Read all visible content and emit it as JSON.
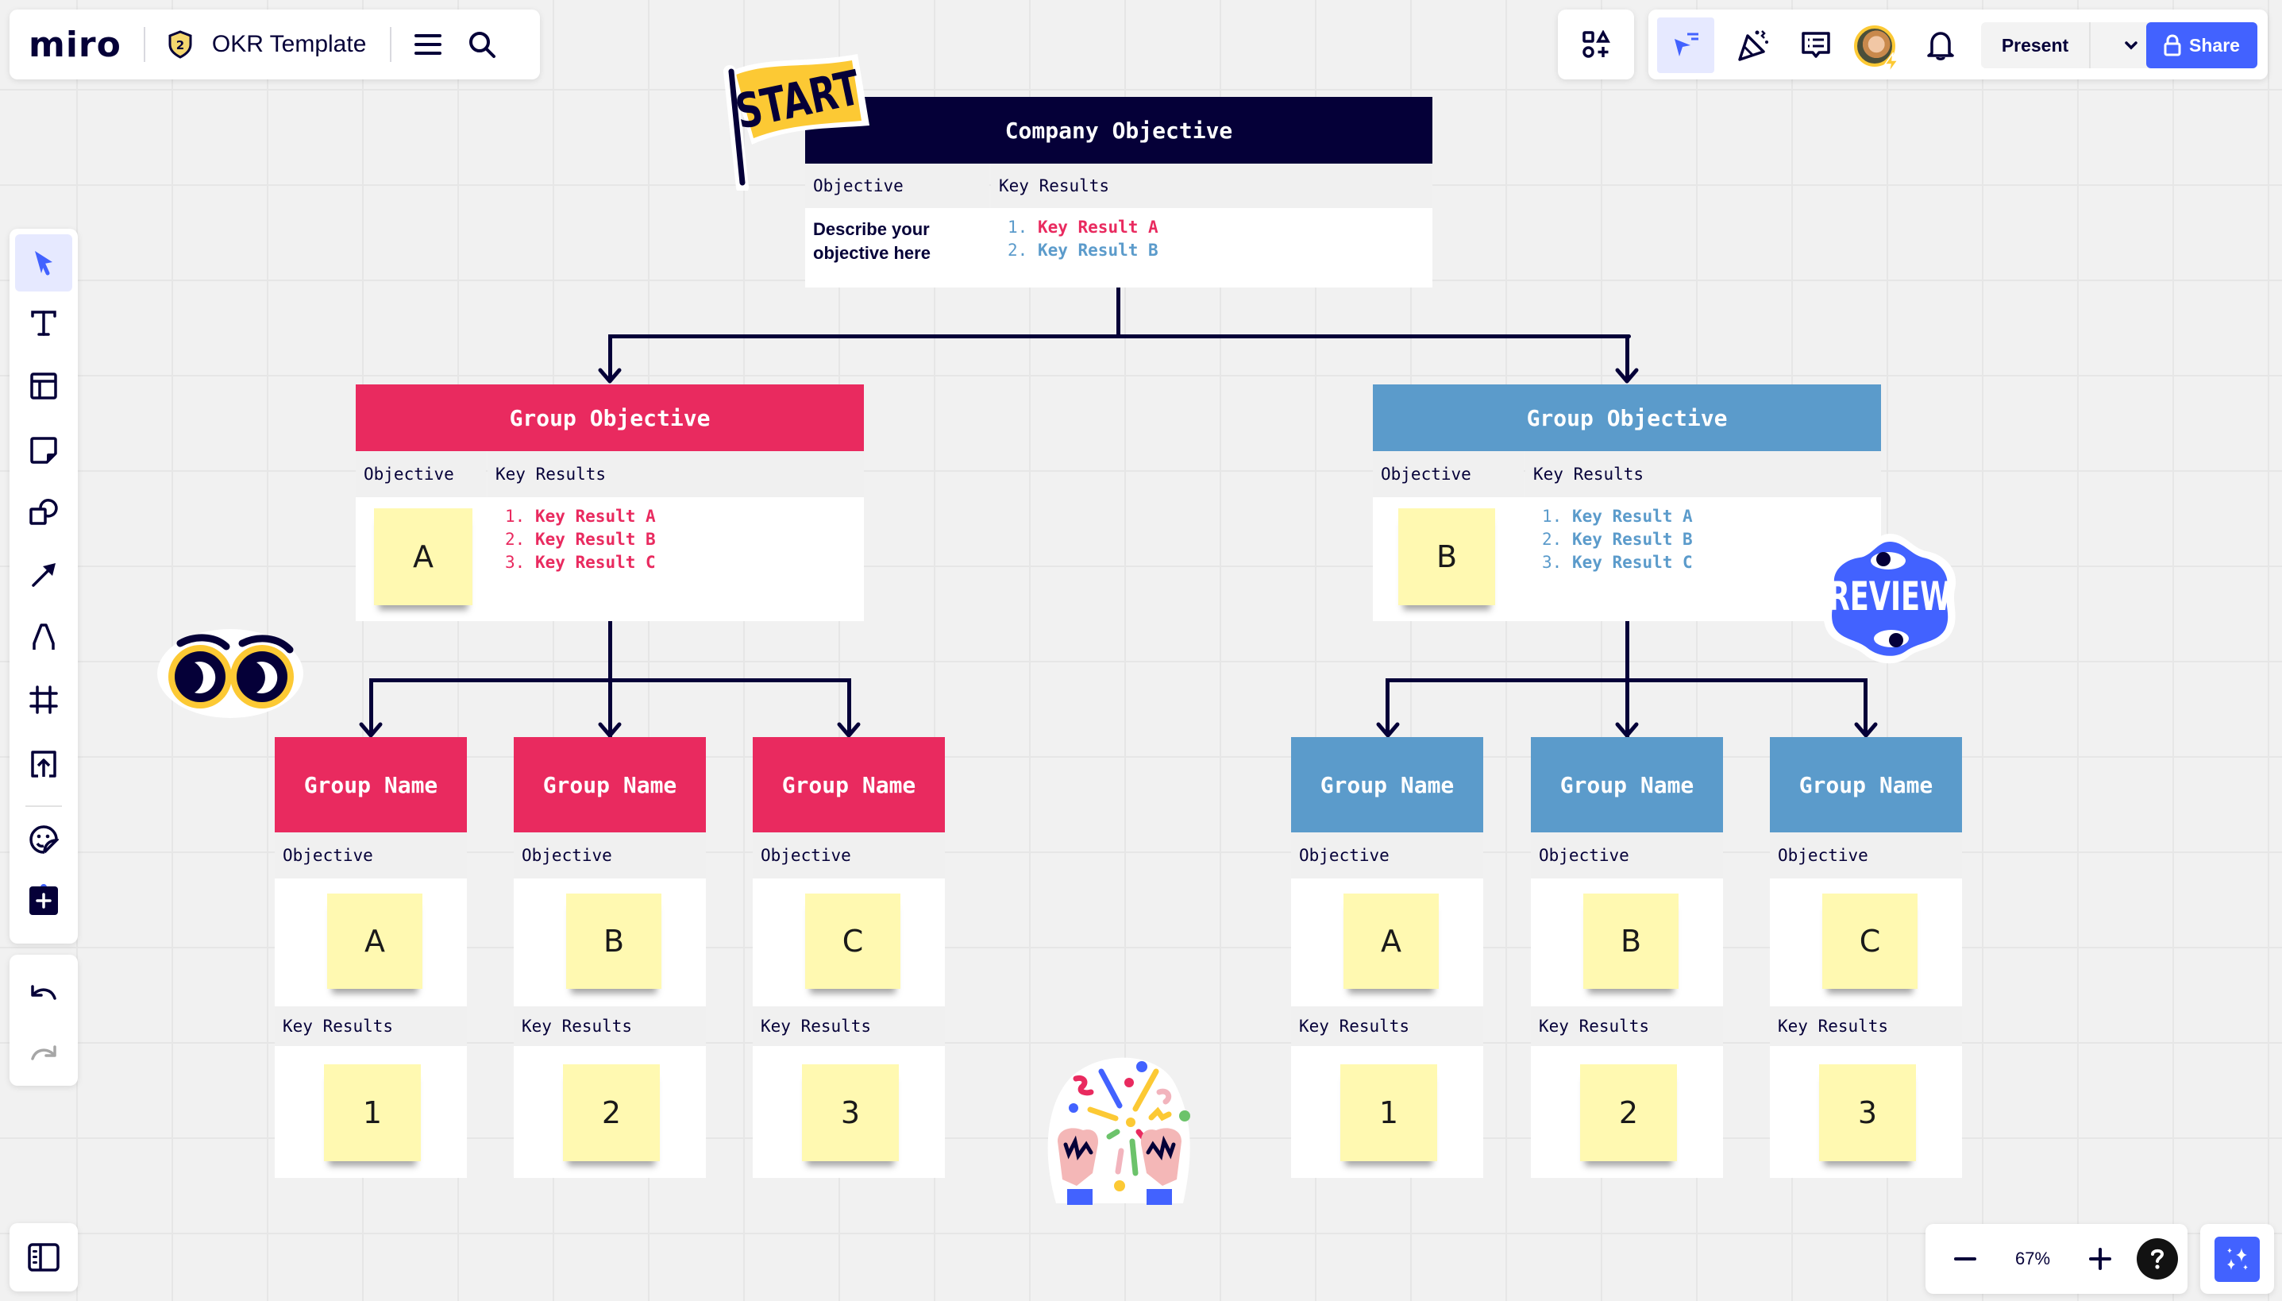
{
  "app": {
    "logo": "miro",
    "board_title": "OKR Template",
    "plan_badge": "2"
  },
  "topbar": {
    "present_label": "Present",
    "share_label": "Share",
    "zoom_level": "67%"
  },
  "toolbar": {
    "tools": [
      "select",
      "text",
      "templates",
      "sticky-note",
      "shapes",
      "arrow",
      "pen",
      "frame",
      "upload",
      "stickers",
      "more-apps"
    ],
    "undo": "undo",
    "redo": "redo"
  },
  "colors": {
    "navy": "#050038",
    "pink": "#e92a5f",
    "blue": "#5b9bcb",
    "sticky": "#fff9b1",
    "accent": "#4262ff"
  },
  "company": {
    "title": "Company Objective",
    "objective_label": "Objective",
    "kr_label": "Key Results",
    "objective_text": "Describe your objective here",
    "key_results": [
      {
        "num": "1.",
        "text": "Key Result A",
        "color": "#e92a5f"
      },
      {
        "num": "2.",
        "text": "Key Result B",
        "color": "#5b9bcb"
      }
    ]
  },
  "groups": [
    {
      "title": "Group Objective",
      "objective_label": "Objective",
      "kr_label": "Key Results",
      "sticky": "A",
      "key_results": [
        {
          "num": "1.",
          "text": "Key Result A"
        },
        {
          "num": "2.",
          "text": "Key Result B"
        },
        {
          "num": "3.",
          "text": "Key Result C"
        }
      ]
    },
    {
      "title": "Group Objective",
      "objective_label": "Objective",
      "kr_label": "Key Results",
      "sticky": "B",
      "key_results": [
        {
          "num": "1.",
          "text": "Key Result A"
        },
        {
          "num": "2.",
          "text": "Key Result B"
        },
        {
          "num": "3.",
          "text": "Key Result C"
        }
      ]
    }
  ],
  "teams": [
    {
      "title": "Group Name",
      "objective_label": "Objective",
      "kr_label": "Key Results",
      "objective": "A",
      "kr": "1"
    },
    {
      "title": "Group Name",
      "objective_label": "Objective",
      "kr_label": "Key Results",
      "objective": "B",
      "kr": "2"
    },
    {
      "title": "Group Name",
      "objective_label": "Objective",
      "kr_label": "Key Results",
      "objective": "C",
      "kr": "3"
    },
    {
      "title": "Group Name",
      "objective_label": "Objective",
      "kr_label": "Key Results",
      "objective": "A",
      "kr": "1"
    },
    {
      "title": "Group Name",
      "objective_label": "Objective",
      "kr_label": "Key Results",
      "objective": "B",
      "kr": "2"
    },
    {
      "title": "Group Name",
      "objective_label": "Objective",
      "kr_label": "Key Results",
      "objective": "C",
      "kr": "3"
    }
  ],
  "stickers": {
    "start": "START",
    "review": "REVIEW"
  }
}
